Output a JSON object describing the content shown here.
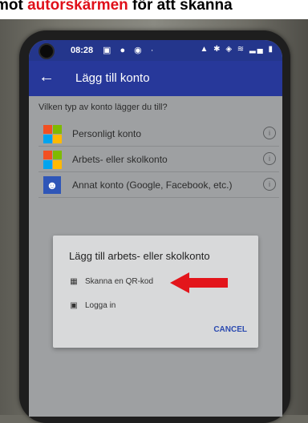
{
  "caption": {
    "prefix": "mot ",
    "highlight": "autorskärmen",
    "suffix": " för att skanna"
  },
  "status_bar": {
    "time": "08:28",
    "left_icons": "▣ ● ◉ ·",
    "right_icons": "▲ ✱ ◈ ≋ ▂▄ ▮"
  },
  "app_bar": {
    "back_icon": "arrow-left-icon",
    "title": "Lägg till konto"
  },
  "account_screen": {
    "question": "Vilken typ av konto lägger du till?",
    "options": [
      {
        "label": "Personligt konto",
        "icon": "microsoft-logo-icon"
      },
      {
        "label": "Arbets- eller skolkonto",
        "icon": "microsoft-logo-icon"
      },
      {
        "label": "Annat konto (Google, Facebook, etc.)",
        "icon": "person-icon"
      }
    ],
    "info_glyph": "i"
  },
  "dialog": {
    "title": "Lägg till arbets- eller skolkonto",
    "scan_label": "Skanna en QR-kod",
    "signin_label": "Logga in",
    "cancel_label": "CANCEL"
  },
  "colors": {
    "app_bar": "#27389a",
    "highlight_text": "#e0101a",
    "annotation_arrow": "#e3151b",
    "cancel_button": "#2b4ab0",
    "ms_red": "#f25022",
    "ms_green": "#7fba00",
    "ms_blue": "#00a4ef",
    "ms_yellow": "#ffb900"
  }
}
